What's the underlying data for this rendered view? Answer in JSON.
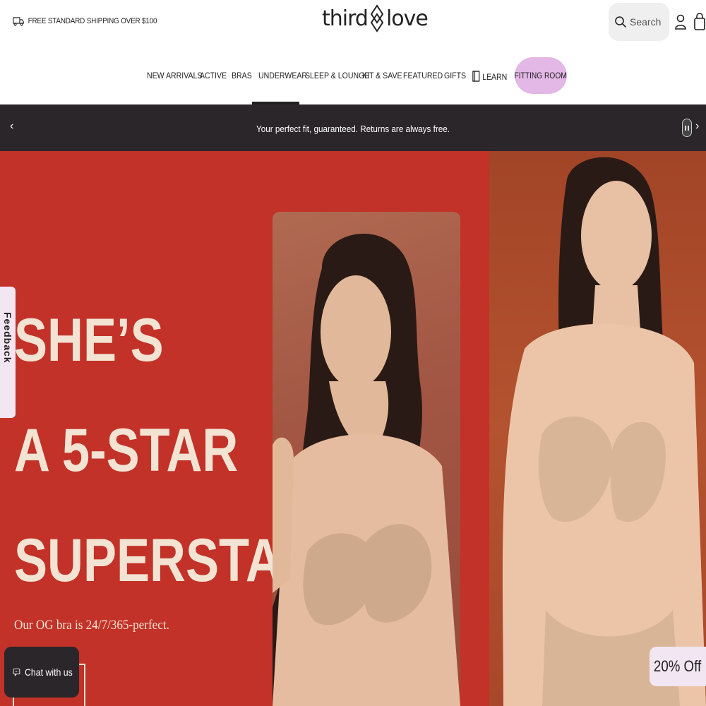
{
  "header": {
    "shipping_text": "FREE STANDARD SHIPPING OVER $100",
    "logo_left": "third",
    "logo_right": "love",
    "search_placeholder": "Search"
  },
  "nav": {
    "items": [
      {
        "label": "NEW ARRIVALS"
      },
      {
        "label": "ACTIVE"
      },
      {
        "label": "BRAS"
      },
      {
        "label": "UNDERWEAR"
      },
      {
        "label": "SLEEP & LOUNGE"
      },
      {
        "label": "KIT & SAVE"
      },
      {
        "label": "FEATURED"
      },
      {
        "label": "GIFTS"
      },
      {
        "label": "LEARN"
      }
    ],
    "active": "UNDERWEAR",
    "fitting_room": "FITTING ROOM"
  },
  "announcement": {
    "message": "Your perfect fit, guaranteed. Returns are always free.",
    "prev_icon": "‹",
    "next_icon": "›"
  },
  "hero": {
    "headline": [
      "SHE’S",
      "A 5-STAR",
      "SUPERSTAR"
    ],
    "subtext": "Our OG bra is 24/7/365-perfect."
  },
  "widgets": {
    "feedback": "Feedback",
    "chat": "Chat with us",
    "discount": "20% Off"
  },
  "colors": {
    "hero_red": "#c23228",
    "headline_cream": "#f3e3d3",
    "fitting_room_pink": "#e3b7e6",
    "announcement_bg": "#2b2629"
  }
}
